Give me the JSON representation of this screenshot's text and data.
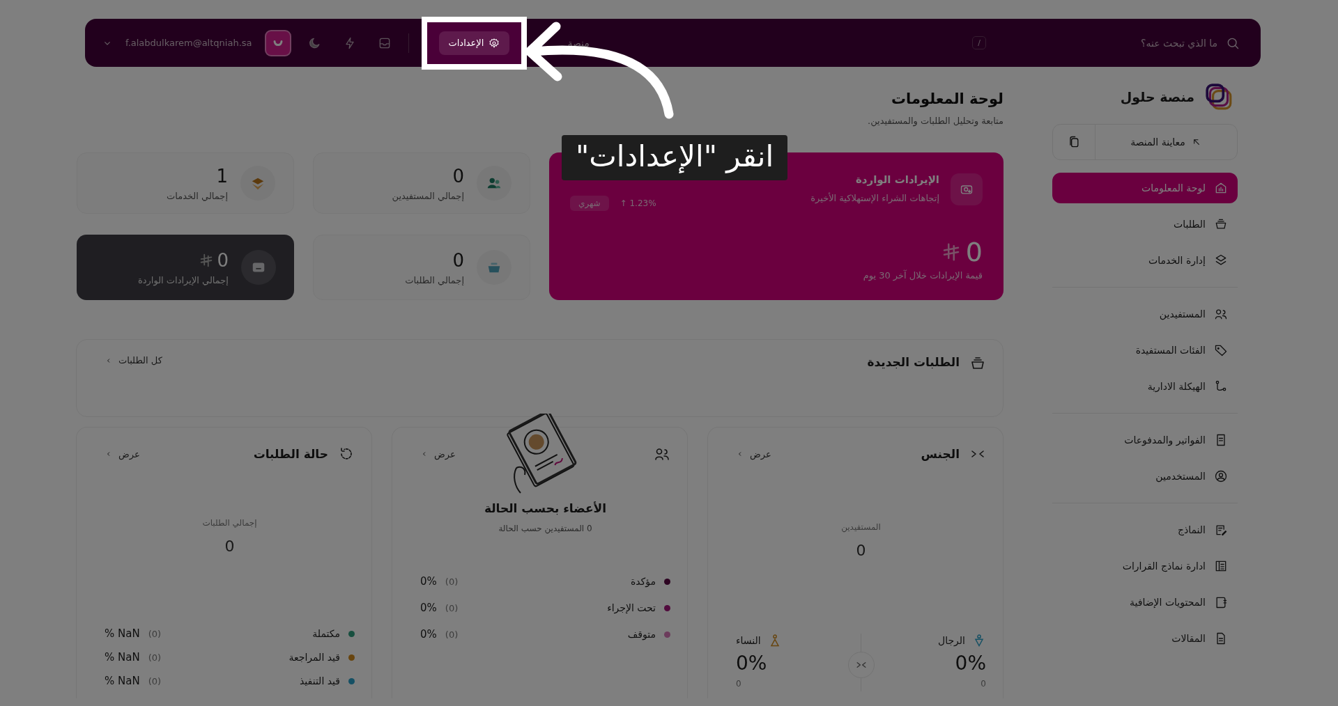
{
  "topbar": {
    "search_placeholder": "ما الذي تبحث عنه؟",
    "shortcut": "/",
    "nav_link": "منصة",
    "settings_button": "الإعدادات",
    "email": "f.alabdulkarem@altqniah.sa"
  },
  "tutorial": {
    "caption": "انقر \"الإعدادات\""
  },
  "sidebar": {
    "brand": "منصة حلول",
    "preview": "معاينة المنصة",
    "groups": [
      [
        {
          "label": "لوحة المعلومات",
          "selected": true
        },
        {
          "label": "الطلبات",
          "selected": false
        },
        {
          "label": "إدارة الخدمات",
          "selected": false
        }
      ],
      [
        {
          "label": "المستفيدين",
          "selected": false
        },
        {
          "label": "الفئات المستفيدة",
          "selected": false
        },
        {
          "label": "الهيكلة الادارية",
          "selected": false
        }
      ],
      [
        {
          "label": "الفواتير والمدفوعات",
          "selected": false
        },
        {
          "label": "المستخدمين",
          "selected": false
        }
      ],
      [
        {
          "label": "النماذج",
          "selected": false
        },
        {
          "label": "ادارة نماذج القرارات",
          "selected": false
        },
        {
          "label": "المحتويات الإضافية",
          "selected": false
        },
        {
          "label": "المقالات",
          "selected": false
        }
      ]
    ]
  },
  "page": {
    "title": "لوحة المعلومات",
    "subtitle": "متابعة وتحليل الطلبات والمستفيدين."
  },
  "revenue_card": {
    "title": "الإيرادات الواردة",
    "subtitle": "إتجاهات الشراء الإستهلاكية الأخيرة",
    "change": "↑ 1.23%",
    "period": "شهري",
    "amount": "0",
    "caption": "قيمة الإيرادات خلال آخر 30 يوم"
  },
  "stats": [
    {
      "kind": "light",
      "value": "0",
      "label": "إجمالي المستفيدين",
      "currency": false
    },
    {
      "kind": "light",
      "value": "1",
      "label": "إجمالي الخدمات",
      "currency": false
    },
    {
      "kind": "light",
      "value": "0",
      "label": "إجمالي الطلبات",
      "currency": false
    },
    {
      "kind": "dark",
      "value": "0",
      "label": "إجمالي الإيرادات الواردة",
      "currency": true
    }
  ],
  "new_orders": {
    "title": "الطلبات الجديدة",
    "link": "كل الطلبات"
  },
  "gender_panel": {
    "title": "الجنس",
    "link": "عرض",
    "center_label": "المستفيدين",
    "center_value": "0",
    "groups": [
      {
        "label": "الرجال",
        "percent": "0%",
        "count": "0",
        "color": "#155064"
      },
      {
        "label": "النساء",
        "percent": "0%",
        "count": "0",
        "color": "#68450f"
      }
    ]
  },
  "members_panel": {
    "link": "عرض",
    "title": "الأعضاء بحسب الحالة",
    "subtitle": "0 المستفيدين حسب الحالة",
    "legend": [
      {
        "label": "مؤكدة",
        "count": "(0)",
        "percent": "0%",
        "color": "#2d0522"
      },
      {
        "label": "تحت الإجراء",
        "count": "(0)",
        "percent": "0%",
        "color": "#510b3d"
      },
      {
        "label": "متوقف",
        "count": "(0)",
        "percent": "0%",
        "color": "#6c3c5c"
      }
    ]
  },
  "status_panel": {
    "title": "حالة الطلبات",
    "link": "عرض",
    "center_label": "إجمالي الطلبات",
    "center_value": "0",
    "legend": [
      {
        "label": "مكتملة",
        "count": "(0)",
        "percent": "% NaN",
        "color": "#174f3f"
      },
      {
        "label": "قيد المراجعة",
        "count": "(0)",
        "percent": "% NaN",
        "color": "#68450f"
      },
      {
        "label": "قيد التنفيذ",
        "count": "(0)",
        "percent": "% NaN",
        "color": "#155064"
      }
    ]
  }
}
